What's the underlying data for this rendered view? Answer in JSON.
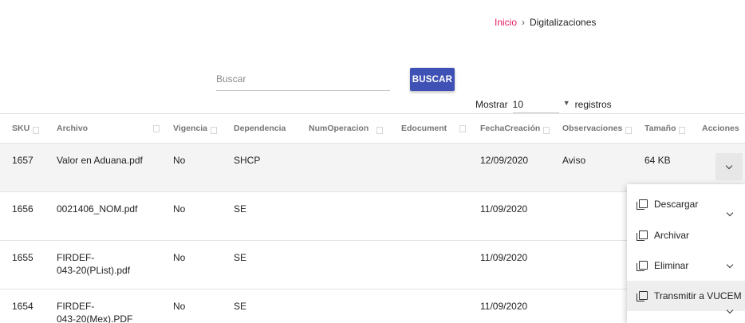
{
  "breadcrumb": {
    "home": "Inicio",
    "separator": "›",
    "current": "Digitalizaciones"
  },
  "search": {
    "placeholder": "Buscar",
    "value": "",
    "button_label": "BUSCAR"
  },
  "paging": {
    "show_label": "Mostrar",
    "page_size": "10",
    "suffix": "registros"
  },
  "table": {
    "headers": {
      "sku": "SKU",
      "archivo": "Archivo",
      "vigencia": "Vigencia",
      "dependencia": "Dependencia",
      "numoperacion": "NumOperacion",
      "edocument": "Edocument",
      "fechacreacion": "FechaCreación",
      "observaciones": "Observaciones",
      "tamano": "Tamaño",
      "acciones": "Acciones"
    },
    "rows": [
      {
        "sku": "1657",
        "archivo": "Valor en Aduana.pdf",
        "archivo_line2": "",
        "vigencia": "No",
        "dependencia": "SHCP",
        "numoperacion": "",
        "edocument": "",
        "fecha": "12/09/2020",
        "observaciones": "Aviso",
        "tamano": "64 KB"
      },
      {
        "sku": "1656",
        "archivo": "0021406_NOM.pdf",
        "archivo_line2": "",
        "vigencia": "No",
        "dependencia": "SE",
        "numoperacion": "",
        "edocument": "",
        "fecha": "11/09/2020",
        "observaciones": "",
        "tamano": ""
      },
      {
        "sku": "1655",
        "archivo": "FIRDEF-",
        "archivo_line2": "043-20(PList).pdf",
        "vigencia": "No",
        "dependencia": "SE",
        "numoperacion": "",
        "edocument": "",
        "fecha": "11/09/2020",
        "observaciones": "",
        "tamano": ""
      },
      {
        "sku": "1654",
        "archivo": "FIRDEF-",
        "archivo_line2": "043-20(Mex).PDF",
        "vigencia": "No",
        "dependencia": "SE",
        "numoperacion": "",
        "edocument": "",
        "fecha": "11/09/2020",
        "observaciones": "",
        "tamano": ""
      }
    ]
  },
  "actions_menu": {
    "items": [
      {
        "label": "Descargar",
        "icon": "file-copy-icon"
      },
      {
        "label": "Archivar",
        "icon": "file-copy-icon"
      },
      {
        "label": "Eliminar",
        "icon": "file-copy-icon"
      },
      {
        "label": "Transmitir a VUCEM",
        "icon": "file-copy-icon"
      }
    ]
  },
  "colors": {
    "primary": "#3f51b5",
    "link": "#e91e63",
    "header_text": "#757575"
  }
}
